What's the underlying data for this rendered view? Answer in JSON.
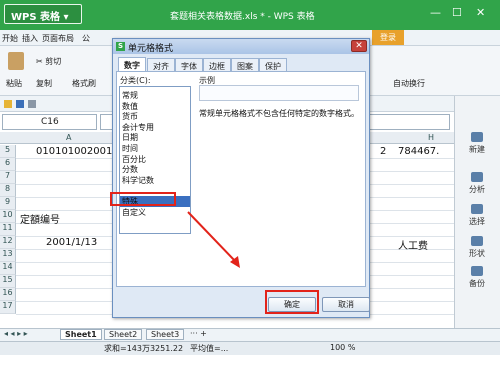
{
  "titlebar": {
    "app_name": "WPS 表格",
    "window_title": "套题相关表格数据.xls * - WPS 表格",
    "minimize": "—",
    "maximize": "☐",
    "close": "✕"
  },
  "menu": {
    "start": "开始",
    "insert": "插入",
    "page_layout": "页面布局",
    "formula": "公"
  },
  "ribbon": {
    "cut": "剪切",
    "paste": "粘贴",
    "copy": "复制",
    "format_painter": "格式刷",
    "autowrap": "自动换行",
    "login": "登录"
  },
  "namebox": {
    "value": "C16"
  },
  "columns": [
    "A",
    "H"
  ],
  "rows": [
    {
      "n": "5",
      "a": "010101002001",
      "g": "2",
      "h": "784467."
    },
    {
      "n": "6",
      "a": ""
    },
    {
      "n": "7",
      "a": ""
    },
    {
      "n": "8",
      "a": ""
    },
    {
      "n": "9",
      "a": ""
    },
    {
      "n": "10",
      "a": "定額编号"
    },
    {
      "n": "11",
      "a": ""
    },
    {
      "n": "12",
      "a": "2001/1/13",
      "h": "人工费"
    },
    {
      "n": "13",
      "a": ""
    },
    {
      "n": "14",
      "a": ""
    },
    {
      "n": "15",
      "a": ""
    },
    {
      "n": "16",
      "a": ""
    },
    {
      "n": "17",
      "a": ""
    }
  ],
  "sheets": [
    "Sheet1",
    "Sheet2",
    "Sheet3"
  ],
  "status": {
    "sum": "求和=143万3251.22",
    "avg": "平均值=...",
    "zoom": "100 %"
  },
  "pane": [
    {
      "icon": "new-icon",
      "label": "新建"
    },
    {
      "icon": "analysis-icon",
      "label": "分析"
    },
    {
      "icon": "select-icon",
      "label": "选择"
    },
    {
      "icon": "shape-icon",
      "label": "形状"
    },
    {
      "icon": "backup-icon",
      "label": "备份"
    }
  ],
  "dialog": {
    "title": "单元格格式",
    "tabs": [
      "数字",
      "对齐",
      "字体",
      "边框",
      "图案",
      "保护"
    ],
    "category_label": "分类(C):",
    "categories": [
      "常规",
      "数值",
      "货币",
      "会计专用",
      "日期",
      "时间",
      "百分比",
      "分数",
      "科学记数",
      "文本",
      "特殊",
      "自定义"
    ],
    "selected_category": "文本",
    "sample_label": "示例",
    "description": "常规单元格格式不包含任何特定的数字格式。",
    "ok": "确定",
    "cancel": "取消"
  },
  "colors": {
    "brand": "#31a44a",
    "annotation": "#e2231a",
    "selection": "#3a6fc0"
  }
}
